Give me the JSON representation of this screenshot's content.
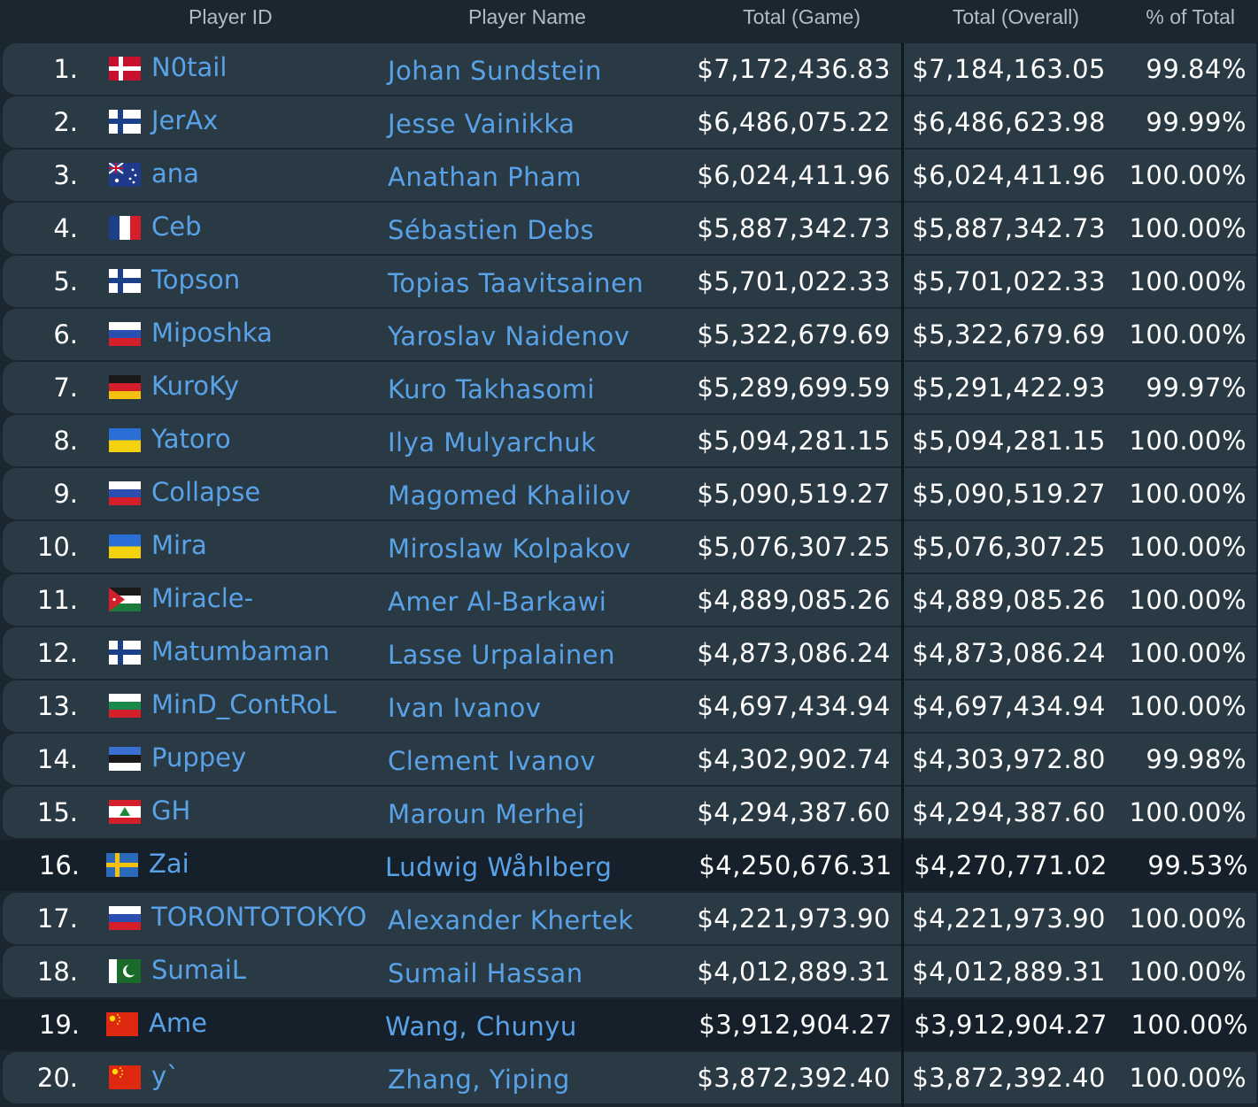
{
  "header": {
    "player_id": "Player ID",
    "player_name": "Player Name",
    "total_game": "Total (Game)",
    "total_overall": "Total (Overall)",
    "pct_total": "% of Total"
  },
  "rows": [
    {
      "rank": "1.",
      "flag": "denmark-flag",
      "id": "N0tail",
      "name": "Johan Sundstein",
      "game": "$7,172,436.83",
      "overall": "$7,184,163.05",
      "pct": "99.84%",
      "dark": false
    },
    {
      "rank": "2.",
      "flag": "finland-flag",
      "id": "JerAx",
      "name": "Jesse Vainikka",
      "game": "$6,486,075.22",
      "overall": "$6,486,623.98",
      "pct": "99.99%",
      "dark": false
    },
    {
      "rank": "3.",
      "flag": "australia-flag",
      "id": "ana",
      "name": "Anathan Pham",
      "game": "$6,024,411.96",
      "overall": "$6,024,411.96",
      "pct": "100.00%",
      "dark": false
    },
    {
      "rank": "4.",
      "flag": "france-flag",
      "id": "Ceb",
      "name": "Sébastien Debs",
      "game": "$5,887,342.73",
      "overall": "$5,887,342.73",
      "pct": "100.00%",
      "dark": false
    },
    {
      "rank": "5.",
      "flag": "finland-flag",
      "id": "Topson",
      "name": "Topias Taavitsainen",
      "game": "$5,701,022.33",
      "overall": "$5,701,022.33",
      "pct": "100.00%",
      "dark": false
    },
    {
      "rank": "6.",
      "flag": "russia-flag",
      "id": "Miposhka",
      "name": "Yaroslav Naidenov",
      "game": "$5,322,679.69",
      "overall": "$5,322,679.69",
      "pct": "100.00%",
      "dark": false
    },
    {
      "rank": "7.",
      "flag": "germany-flag",
      "id": "KuroKy",
      "name": "Kuro Takhasomi",
      "game": "$5,289,699.59",
      "overall": "$5,291,422.93",
      "pct": "99.97%",
      "dark": false
    },
    {
      "rank": "8.",
      "flag": "ukraine-flag",
      "id": "Yatoro",
      "name": "Ilya Mulyarchuk",
      "game": "$5,094,281.15",
      "overall": "$5,094,281.15",
      "pct": "100.00%",
      "dark": false
    },
    {
      "rank": "9.",
      "flag": "russia-flag",
      "id": "Collapse",
      "name": "Magomed Khalilov",
      "game": "$5,090,519.27",
      "overall": "$5,090,519.27",
      "pct": "100.00%",
      "dark": false
    },
    {
      "rank": "10.",
      "flag": "ukraine-flag",
      "id": "Mira",
      "name": "Miroslaw Kolpakov",
      "game": "$5,076,307.25",
      "overall": "$5,076,307.25",
      "pct": "100.00%",
      "dark": false
    },
    {
      "rank": "11.",
      "flag": "jordan-flag",
      "id": "Miracle-",
      "name": "Amer Al-Barkawi",
      "game": "$4,889,085.26",
      "overall": "$4,889,085.26",
      "pct": "100.00%",
      "dark": false
    },
    {
      "rank": "12.",
      "flag": "finland-flag",
      "id": "Matumbaman",
      "name": "Lasse Urpalainen",
      "game": "$4,873,086.24",
      "overall": "$4,873,086.24",
      "pct": "100.00%",
      "dark": false
    },
    {
      "rank": "13.",
      "flag": "bulgaria-flag",
      "id": "MinD_ContRoL",
      "name": "Ivan Ivanov",
      "game": "$4,697,434.94",
      "overall": "$4,697,434.94",
      "pct": "100.00%",
      "dark": false
    },
    {
      "rank": "14.",
      "flag": "estonia-flag",
      "id": "Puppey",
      "name": "Clement Ivanov",
      "game": "$4,302,902.74",
      "overall": "$4,303,972.80",
      "pct": "99.98%",
      "dark": false
    },
    {
      "rank": "15.",
      "flag": "lebanon-flag",
      "id": "GH",
      "name": "Maroun Merhej",
      "game": "$4,294,387.60",
      "overall": "$4,294,387.60",
      "pct": "100.00%",
      "dark": false
    },
    {
      "rank": "16.",
      "flag": "sweden-flag",
      "id": "Zai",
      "name": "Ludwig Wåhlberg",
      "game": "$4,250,676.31",
      "overall": "$4,270,771.02",
      "pct": "99.53%",
      "dark": true
    },
    {
      "rank": "17.",
      "flag": "russia-flag",
      "id": "TORONTOTOKYO",
      "name": "Alexander Khertek",
      "game": "$4,221,973.90",
      "overall": "$4,221,973.90",
      "pct": "100.00%",
      "dark": false
    },
    {
      "rank": "18.",
      "flag": "pakistan-flag",
      "id": "SumaiL",
      "name": "Sumail Hassan",
      "game": "$4,012,889.31",
      "overall": "$4,012,889.31",
      "pct": "100.00%",
      "dark": false
    },
    {
      "rank": "19.",
      "flag": "china-flag",
      "id": "Ame",
      "name": "Wang, Chunyu",
      "game": "$3,912,904.27",
      "overall": "$3,912,904.27",
      "pct": "100.00%",
      "dark": true
    },
    {
      "rank": "20.",
      "flag": "china-flag",
      "id": "y`",
      "name": "Zhang, Yiping",
      "game": "$3,872,392.40",
      "overall": "$3,872,392.40",
      "pct": "100.00%",
      "dark": false
    }
  ]
}
